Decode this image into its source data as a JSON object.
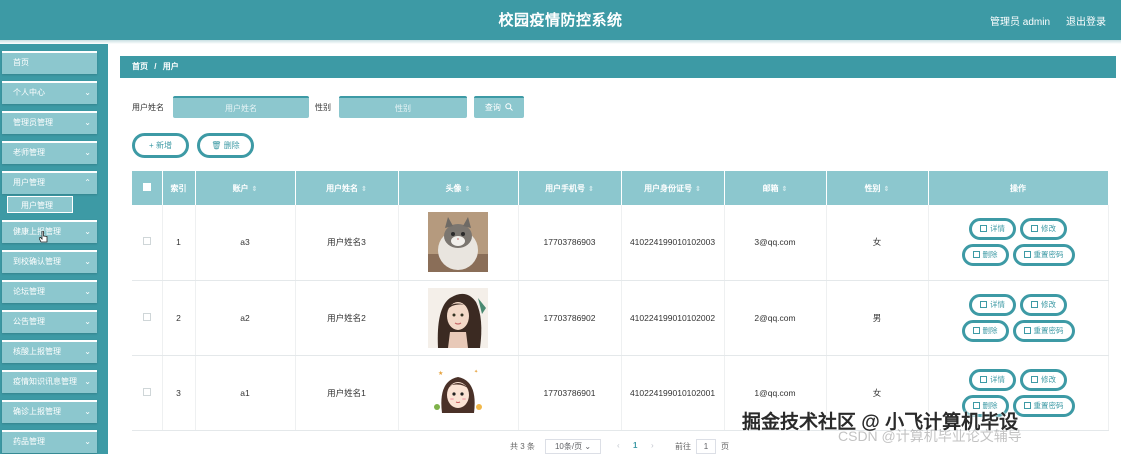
{
  "header": {
    "title": "校园疫情防控系统",
    "admin": "管理员 admin",
    "logout": "退出登录"
  },
  "sidebar": {
    "items": [
      {
        "label": "首页",
        "chevron": false
      },
      {
        "label": "个人中心",
        "chevron": true
      },
      {
        "label": "管理员管理",
        "chevron": true
      },
      {
        "label": "老师管理",
        "chevron": true
      },
      {
        "label": "用户管理",
        "chevron": true
      },
      {
        "label": "健康上报管理",
        "chevron": true
      },
      {
        "label": "到校确认管理",
        "chevron": true
      },
      {
        "label": "论坛管理",
        "chevron": true
      },
      {
        "label": "公告管理",
        "chevron": true
      },
      {
        "label": "核酸上报管理",
        "chevron": true
      },
      {
        "label": "疫情知识讯息管理",
        "chevron": true
      },
      {
        "label": "确诊上报管理",
        "chevron": true
      },
      {
        "label": "药品管理",
        "chevron": true
      }
    ],
    "sub_item": "用户管理"
  },
  "breadcrumb": {
    "home": "首页",
    "sep": "/",
    "current": "用户"
  },
  "search": {
    "name_label": "用户姓名",
    "name_placeholder": "用户姓名",
    "gender_label": "性别",
    "gender_placeholder": "性别",
    "button": "查询"
  },
  "actions": {
    "add": "新增",
    "delete": "删除"
  },
  "table": {
    "headers": [
      "索引",
      "账户",
      "用户姓名",
      "头像",
      "用户手机号",
      "用户身份证号",
      "邮箱",
      "性别",
      "操作"
    ],
    "rows": [
      {
        "index": "1",
        "account": "a3",
        "name": "用户姓名3",
        "avatar": "cat-avatar",
        "phone": "17703786903",
        "idcard": "410224199010102003",
        "email": "3@qq.com",
        "gender": "女"
      },
      {
        "index": "2",
        "account": "a2",
        "name": "用户姓名2",
        "avatar": "girl-avatar",
        "phone": "17703786902",
        "idcard": "410224199010102002",
        "email": "2@qq.com",
        "gender": "男"
      },
      {
        "index": "3",
        "account": "a1",
        "name": "用户姓名1",
        "avatar": "cartoon-girl-avatar",
        "phone": "17703786901",
        "idcard": "410224199010102001",
        "email": "1@qq.com",
        "gender": "女"
      }
    ],
    "row_actions": {
      "detail": "详情",
      "edit": "修改",
      "delete": "删除",
      "reset": "重置密码"
    }
  },
  "pagination": {
    "total": "共 3 条",
    "page_size": "10条/页",
    "current": "1",
    "goto": "前往",
    "goto_value": "1",
    "page_unit": "页"
  },
  "watermark": {
    "main": "掘金技术社区 @ 小飞计算机毕设",
    "sub": "CSDN @计算机毕业论文辅导"
  },
  "colors": {
    "primary": "#3d9aa5",
    "light": "#8cc7ce"
  }
}
